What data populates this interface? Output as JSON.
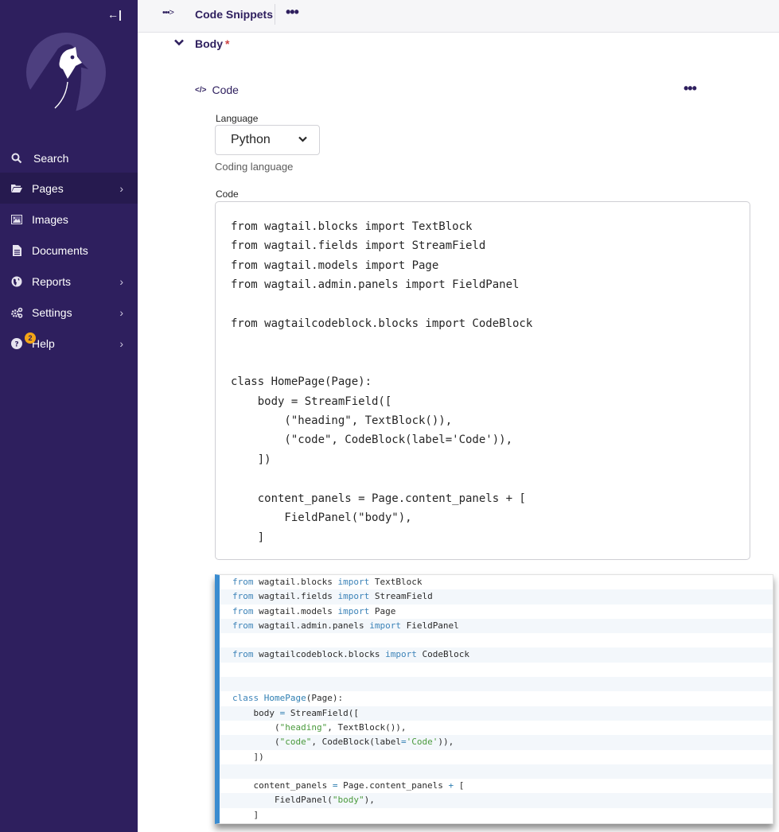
{
  "sidebar": {
    "collapse_icon": "collapse-sidebar-icon",
    "logo": "wagtail-bird-logo",
    "items": [
      {
        "label": "Search",
        "icon": "search-icon",
        "has_submenu": false,
        "active": false
      },
      {
        "label": "Pages",
        "icon": "folder-open-icon",
        "has_submenu": true,
        "active": true
      },
      {
        "label": "Images",
        "icon": "image-icon",
        "has_submenu": false,
        "active": false
      },
      {
        "label": "Documents",
        "icon": "document-icon",
        "has_submenu": false,
        "active": false
      },
      {
        "label": "Reports",
        "icon": "globe-icon",
        "has_submenu": true,
        "active": false
      },
      {
        "label": "Settings",
        "icon": "cogs-icon",
        "has_submenu": true,
        "active": false
      },
      {
        "label": "Help",
        "icon": "help-icon",
        "has_submenu": true,
        "active": false,
        "badge": "2"
      }
    ]
  },
  "header": {
    "breadcrumb_toggle": "•••>",
    "title": "Code Snippets",
    "more_label": "•••"
  },
  "body_field": {
    "label": "Body",
    "required_marker": "*",
    "toggle": "⌄"
  },
  "code_block": {
    "icon_text": "</>",
    "title": "Code",
    "more_label": "•••",
    "language_label": "Language",
    "language_value": "Python",
    "language_help": "Coding language",
    "code_label": "Code",
    "code_value": "from wagtail.blocks import TextBlock\nfrom wagtail.fields import StreamField\nfrom wagtail.models import Page\nfrom wagtail.admin.panels import FieldPanel\n\nfrom wagtailcodeblock.blocks import CodeBlock\n\n\nclass HomePage(Page):\n    body = StreamField([\n        (\"heading\", TextBlock()),\n        (\"code\", CodeBlock(label='Code')),\n    ])\n\n    content_panels = Page.content_panels + [\n        FieldPanel(\"body\"),\n    ]"
  },
  "preview": {
    "accent_color": "#3a8cd0",
    "lines": [
      "from wagtail.blocks import TextBlock",
      "from wagtail.fields import StreamField",
      "from wagtail.models import Page",
      "from wagtail.admin.panels import FieldPanel",
      "",
      "from wagtailcodeblock.blocks import CodeBlock",
      "",
      "",
      "class HomePage(Page):",
      "    body = StreamField([",
      "        (\"heading\", TextBlock()),",
      "        (\"code\", CodeBlock(label='Code')),",
      "    ])",
      "",
      "    content_panels = Page.content_panels + [",
      "        FieldPanel(\"body\"),",
      "    ]"
    ]
  }
}
